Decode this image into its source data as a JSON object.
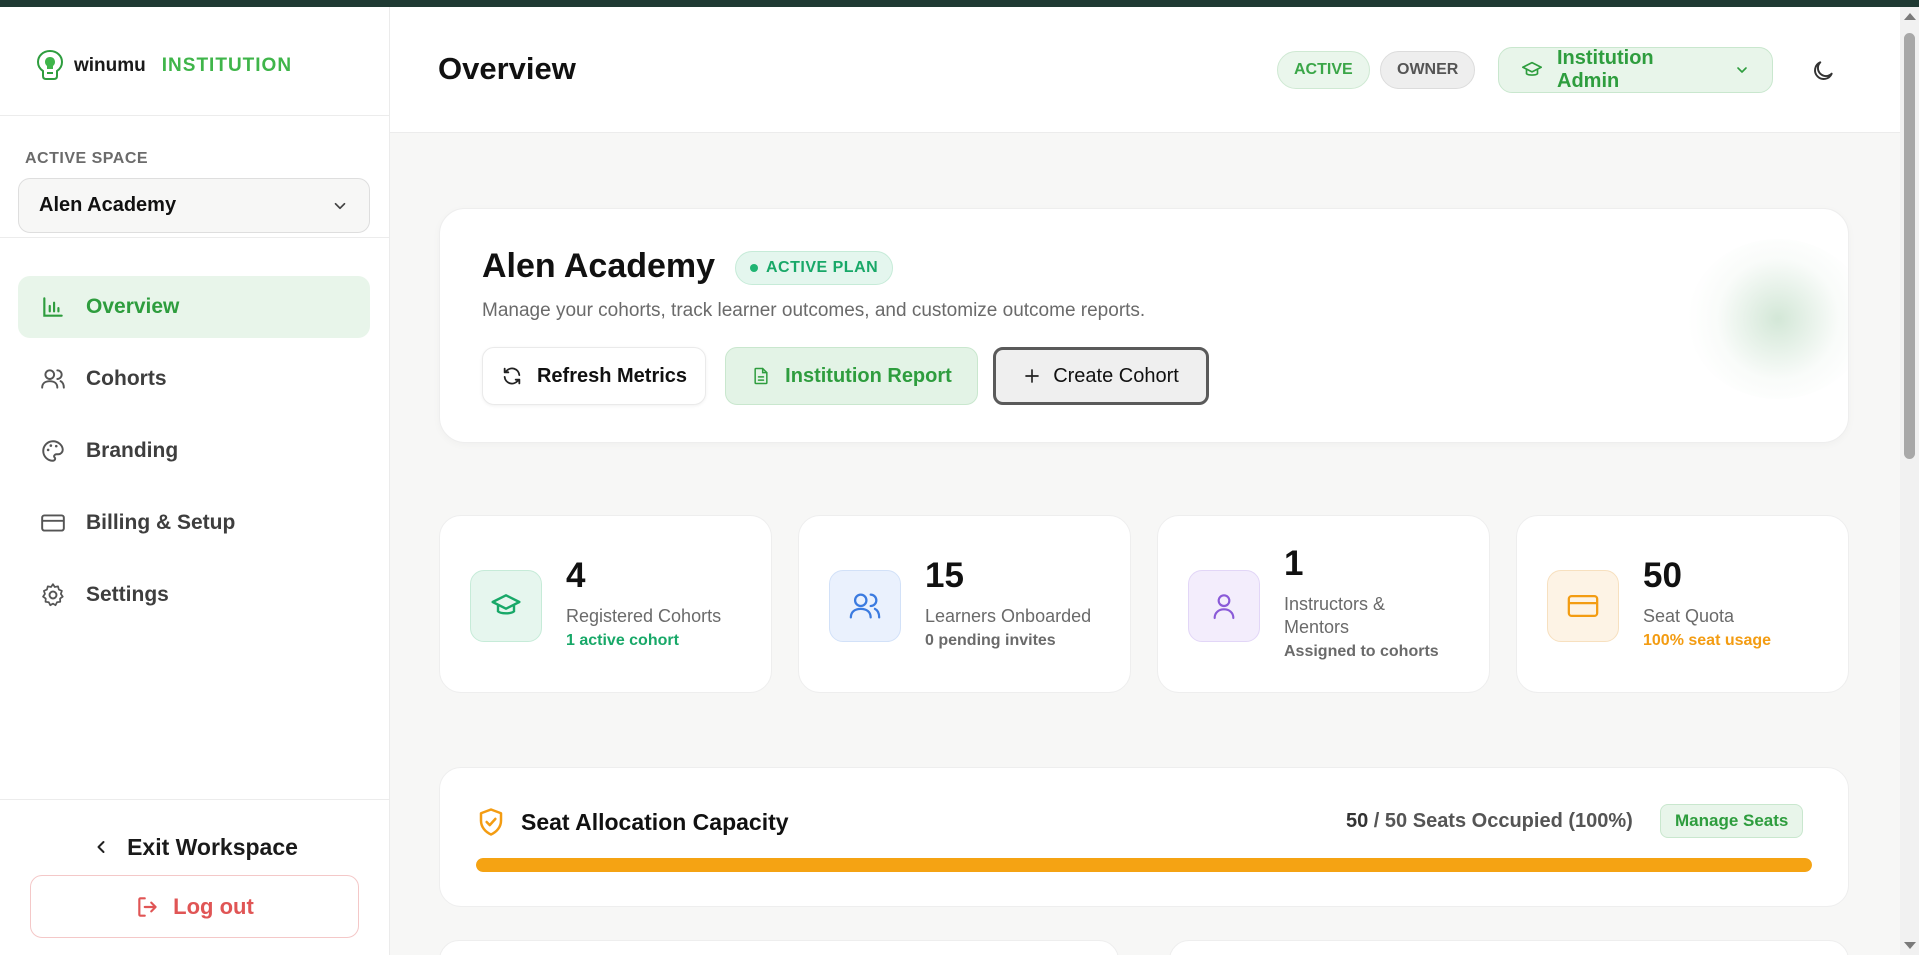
{
  "brand": {
    "name": "winumu",
    "tag": "INSTITUTION"
  },
  "sidebar": {
    "space_label": "ACTIVE SPACE",
    "space_value": "Alen Academy",
    "items": [
      {
        "label": "Overview",
        "icon": "bar-chart-icon",
        "active": true
      },
      {
        "label": "Cohorts",
        "icon": "users-icon",
        "active": false
      },
      {
        "label": "Branding",
        "icon": "palette-icon",
        "active": false
      },
      {
        "label": "Billing & Setup",
        "icon": "credit-card-icon",
        "active": false
      },
      {
        "label": "Settings",
        "icon": "gear-icon",
        "active": false
      }
    ],
    "exit_label": "Exit Workspace",
    "logout_label": "Log out"
  },
  "header": {
    "title": "Overview",
    "badge_active": "ACTIVE",
    "badge_owner": "OWNER",
    "role_label": "Institution Admin"
  },
  "hero": {
    "title": "Alen Academy",
    "plan_badge": "ACTIVE PLAN",
    "subtitle": "Manage your cohorts, track learner outcomes, and customize outcome reports.",
    "refresh_label": "Refresh Metrics",
    "report_label": "Institution Report",
    "create_label": "Create Cohort"
  },
  "stats": [
    {
      "value": "4",
      "label": "Registered Cohorts",
      "sub": "1 active cohort",
      "sub_color": "#18a868",
      "icon": "graduation-cap-icon"
    },
    {
      "value": "15",
      "label": "Learners Onboarded",
      "sub": "0 pending invites",
      "sub_color": "#6a6a6a",
      "icon": "users-icon"
    },
    {
      "value": "1",
      "label": "Instructors & Mentors",
      "sub": "Assigned to cohorts",
      "sub_color": "#6a6a6a",
      "icon": "user-icon"
    },
    {
      "value": "50",
      "label": "Seat Quota",
      "sub": "100% seat usage",
      "sub_color": "#f39c12",
      "icon": "credit-card-icon"
    }
  ],
  "capacity": {
    "title": "Seat Allocation Capacity",
    "occupied": "50",
    "separator": " / ",
    "summary": "50 Seats Occupied (100%)",
    "manage_label": "Manage Seats",
    "fill_fraction": 1.0
  },
  "colors": {
    "accent": "#3fb54a",
    "accent_dark": "#2e9d3e",
    "warning": "#f5a313",
    "topbar": "#1f3a33"
  }
}
